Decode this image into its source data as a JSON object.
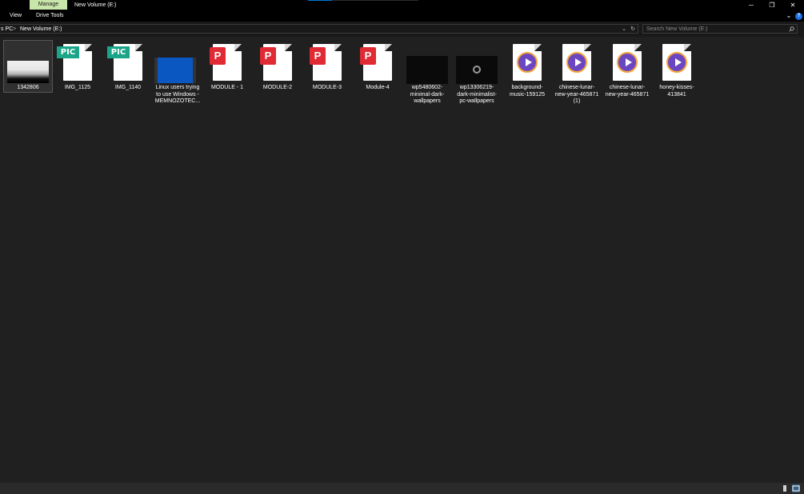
{
  "titlebar": {
    "manage_tab": "Manage",
    "title": "New Volume (E:)",
    "minimize": "─",
    "restore": "❐",
    "close": "✕"
  },
  "ribbon": {
    "tabs": [
      "View",
      "Drive Tools"
    ],
    "expand": "⌄",
    "help": "?"
  },
  "address": {
    "crumbs": [
      "s PC",
      "New Volume (E:)"
    ],
    "separator": ">",
    "dropdown": "⌄",
    "refresh": "↻"
  },
  "search": {
    "placeholder": "Search New Volume (E:)"
  },
  "files": [
    {
      "name": "1342806",
      "type": "image-photo"
    },
    {
      "name": "IMG_1125",
      "type": "pic"
    },
    {
      "name": "IMG_1140",
      "type": "pic"
    },
    {
      "name": "Linux users trying to use Windows - MEMNOZOTEC...",
      "type": "video-thumb"
    },
    {
      "name": "MODULE - 1",
      "type": "pdf"
    },
    {
      "name": "MODULE-2",
      "type": "pdf"
    },
    {
      "name": "MODULE-3",
      "type": "pdf"
    },
    {
      "name": "Module-4",
      "type": "pdf"
    },
    {
      "name": "wp5480602-minimal-dark-wallpapers",
      "type": "image-dark"
    },
    {
      "name": "wp13306219-dark-minimalist-pc-wallpapers",
      "type": "image-dark-ring"
    },
    {
      "name": "background-music-159125",
      "type": "media"
    },
    {
      "name": "chinese-lunar-new-year-465871 (1)",
      "type": "media"
    },
    {
      "name": "chinese-lunar-new-year-465871",
      "type": "media"
    },
    {
      "name": "honey-kisses-413841",
      "type": "media"
    }
  ],
  "icons": {
    "pic_badge": "PIC",
    "pdf_badge": "P"
  },
  "colors": {
    "manage_tab": "#c8e6a9",
    "pic_badge": "#1aa589",
    "pdf_badge": "#e02b35",
    "accent": "#0078d7"
  }
}
